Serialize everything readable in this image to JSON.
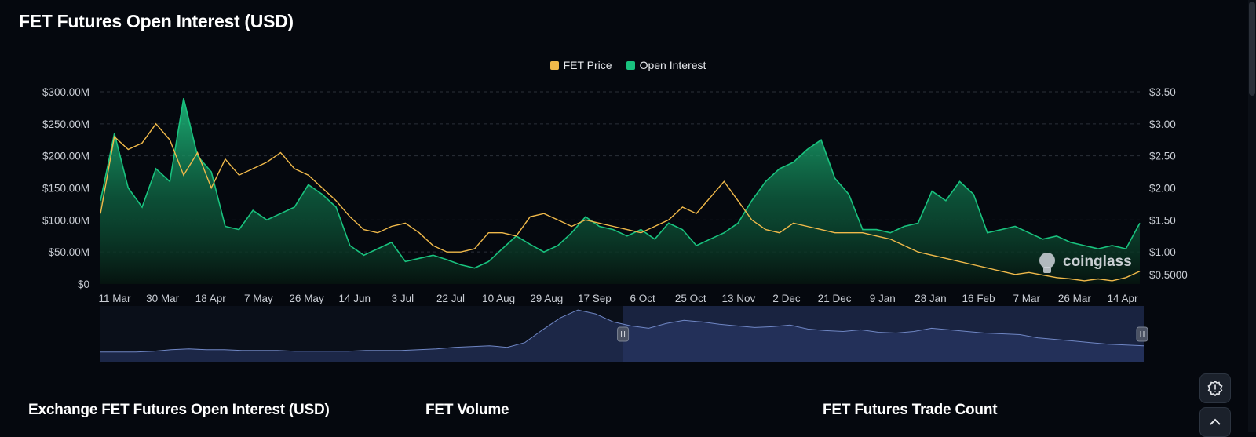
{
  "page": {
    "title": "FET Futures Open Interest (USD)"
  },
  "legend": [
    {
      "label": "FET Price",
      "color": "#f0b94a"
    },
    {
      "label": "Open Interest",
      "color": "#19c27e"
    }
  ],
  "watermark": "coinglass",
  "sections": [
    {
      "title": "Exchange FET Futures Open Interest (USD)"
    },
    {
      "title": "FET Volume"
    },
    {
      "title": "FET Futures Trade Count"
    }
  ],
  "buttons": {
    "alert_icon": "alert-circle-icon",
    "scroll_top_icon": "chevron-up-icon"
  },
  "chart_data": {
    "type": "area",
    "x": [
      "11 Mar",
      "30 Mar",
      "18 Apr",
      "7 May",
      "26 May",
      "14 Jun",
      "3 Jul",
      "22 Jul",
      "10 Aug",
      "29 Aug",
      "17 Sep",
      "6 Oct",
      "25 Oct",
      "13 Nov",
      "2 Dec",
      "21 Dec",
      "9 Jan",
      "28 Jan",
      "16 Feb",
      "7 Mar",
      "26 Mar",
      "14 Apr"
    ],
    "y_left_ticks": [
      "$300.00M",
      "$250.00M",
      "$200.00M",
      "$150.00M",
      "$100.00M",
      "$50.00M",
      "$0"
    ],
    "y_right_ticks": [
      "$3.50",
      "$3.00",
      "$2.50",
      "$2.00",
      "$1.50",
      "$1.00",
      "$0.5000"
    ],
    "y_left_range": [
      0,
      300
    ],
    "y_right_range": [
      0.5,
      3.5
    ],
    "grid": true,
    "legend_position": "top-center",
    "series": [
      {
        "name": "Open Interest",
        "axis": "left",
        "unit": "$M",
        "color": "#19c27e",
        "values": [
          130,
          235,
          150,
          120,
          180,
          160,
          290,
          200,
          175,
          90,
          85,
          115,
          100,
          110,
          120,
          155,
          140,
          120,
          60,
          45,
          55,
          65,
          35,
          40,
          45,
          38,
          30,
          25,
          35,
          55,
          75,
          62,
          50,
          60,
          80,
          105,
          90,
          85,
          75,
          85,
          70,
          95,
          85,
          60,
          70,
          80,
          95,
          130,
          160,
          180,
          190,
          210,
          225,
          165,
          140,
          85,
          85,
          80,
          90,
          95,
          145,
          130,
          160,
          140,
          80,
          85,
          90,
          80,
          70,
          75,
          65,
          60,
          55,
          60,
          55,
          95
        ]
      },
      {
        "name": "FET Price",
        "axis": "right",
        "unit": "$",
        "color": "#f0b94a",
        "values": [
          1.6,
          2.8,
          2.6,
          2.7,
          3.0,
          2.75,
          2.2,
          2.55,
          2.0,
          2.45,
          2.2,
          2.3,
          2.4,
          2.55,
          2.3,
          2.2,
          2.0,
          1.8,
          1.55,
          1.35,
          1.3,
          1.4,
          1.45,
          1.3,
          1.1,
          1.0,
          1.0,
          1.05,
          1.3,
          1.3,
          1.25,
          1.55,
          1.6,
          1.5,
          1.4,
          1.5,
          1.45,
          1.4,
          1.35,
          1.3,
          1.4,
          1.5,
          1.7,
          1.6,
          1.85,
          2.1,
          1.8,
          1.5,
          1.35,
          1.3,
          1.45,
          1.4,
          1.35,
          1.3,
          1.3,
          1.3,
          1.25,
          1.2,
          1.1,
          1.0,
          0.95,
          0.9,
          0.85,
          0.8,
          0.75,
          0.7,
          0.65,
          0.68,
          0.64,
          0.6,
          0.58,
          0.55,
          0.58,
          0.55,
          0.6,
          0.7
        ]
      }
    ],
    "navigator": {
      "type": "area",
      "selected_range": [
        "6 Oct",
        "14 Apr"
      ],
      "values": [
        12,
        12,
        12,
        13,
        15,
        16,
        15,
        15,
        14,
        14,
        14,
        13,
        13,
        13,
        13,
        14,
        14,
        14,
        15,
        16,
        18,
        19,
        20,
        18,
        24,
        40,
        55,
        65,
        60,
        50,
        45,
        42,
        48,
        52,
        50,
        47,
        45,
        43,
        44,
        46,
        41,
        39,
        38,
        40,
        37,
        36,
        38,
        42,
        40,
        38,
        36,
        35,
        34,
        30,
        28,
        26,
        24,
        22,
        21,
        20
      ]
    }
  }
}
